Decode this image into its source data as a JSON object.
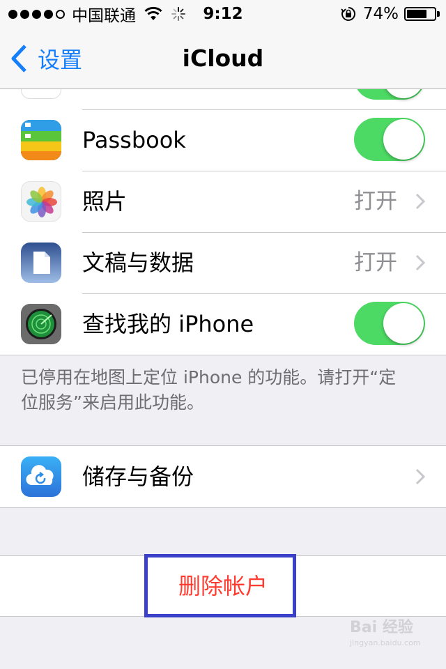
{
  "status_bar": {
    "carrier": "中国联通",
    "time": "9:12",
    "battery_percent_label": "74%",
    "battery_level": 0.74,
    "signal_bars": 4,
    "signal_total": 5
  },
  "nav": {
    "back_label": "设置",
    "title": "iCloud"
  },
  "group_apps": {
    "rows": [
      {
        "label": "Passbook",
        "control": "toggle",
        "on": true,
        "icon": "passbook-icon"
      },
      {
        "label": "照片",
        "control": "value",
        "value": "打开",
        "icon": "photos-icon"
      },
      {
        "label": "文稿与数据",
        "control": "value",
        "value": "打开",
        "icon": "documents-icon"
      },
      {
        "label": "查找我的 iPhone",
        "control": "toggle",
        "on": true,
        "icon": "find-my-iphone-icon"
      }
    ],
    "footer": "已停用在地图上定位 iPhone 的功能。请打开“定位服务”来启用此功能。"
  },
  "group_storage": {
    "rows": [
      {
        "label": "储存与备份",
        "control": "chevron",
        "icon": "icloud-backup-icon"
      }
    ]
  },
  "delete_account": {
    "label": "删除帐户"
  },
  "watermark": {
    "brand": "Bai 经验",
    "sub": "jingyan.baidu.com"
  },
  "colors": {
    "accent": "#157efb",
    "toggle_on": "#4cd964",
    "destructive": "#ff3b30",
    "highlight_box": "#3b40c8"
  }
}
